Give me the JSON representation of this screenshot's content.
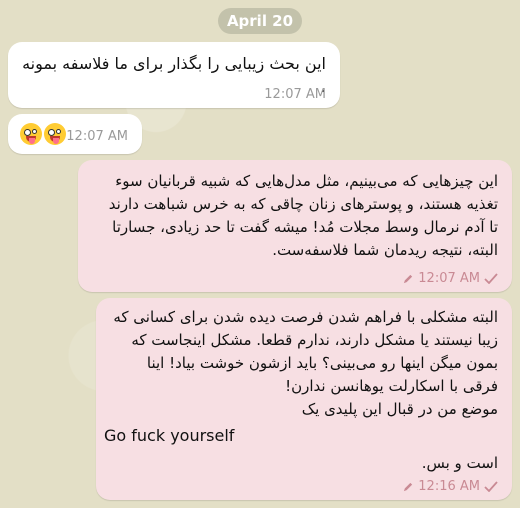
{
  "date_label": "April 20",
  "messages": [
    {
      "direction": "incoming",
      "text": "این بحث زیبایی را بگذار برای ما فلاسفه بمونه .",
      "time": "12:07 AM"
    },
    {
      "direction": "incoming",
      "emoji": [
        "zany-face",
        "zany-face"
      ],
      "time": "12:07 AM"
    },
    {
      "direction": "outgoing",
      "lines": [
        "این چیزهایی که می‌بینیم، مثل مدل‌هایی که شبیه قربانیان سوء",
        "تغذیه هستند، و پوسترهای زنان چاقی که به خرس شباهت دارند",
        "تا آدم نرمال وسط مجلات مُد! میشه گفت تا حد زیادی، جسارتا",
        "البته، نتیجه ریدمان شما فلاسفه‌ست."
      ],
      "edited": true,
      "time": "12:07 AM",
      "status": "sent"
    },
    {
      "direction": "outgoing",
      "lines": [
        "البته مشکلی با فراهم شدن فرصت دیده شدن برای کسانی که",
        "زیبا نیستند یا مشکل دارند، ندارم قطعا. مشکل اینجاست که",
        "بمون میگن اینها رو می‌بینی؟ باید ازشون خوشت بیاد! اینا",
        "فرقی با اسکارلت یوهانسن ندارن!",
        "موضع من در قبال این پلیدی یک"
      ],
      "english_line": "Go fuck yourself",
      "closing_line": "است و بس.",
      "edited": true,
      "time": "12:16 AM",
      "status": "sent"
    }
  ],
  "colors": {
    "incoming_bubble": "#ffffff",
    "outgoing_bubble": "#f7dfe3",
    "outgoing_meta": "#c98a94",
    "background": "#e3dfc6"
  }
}
